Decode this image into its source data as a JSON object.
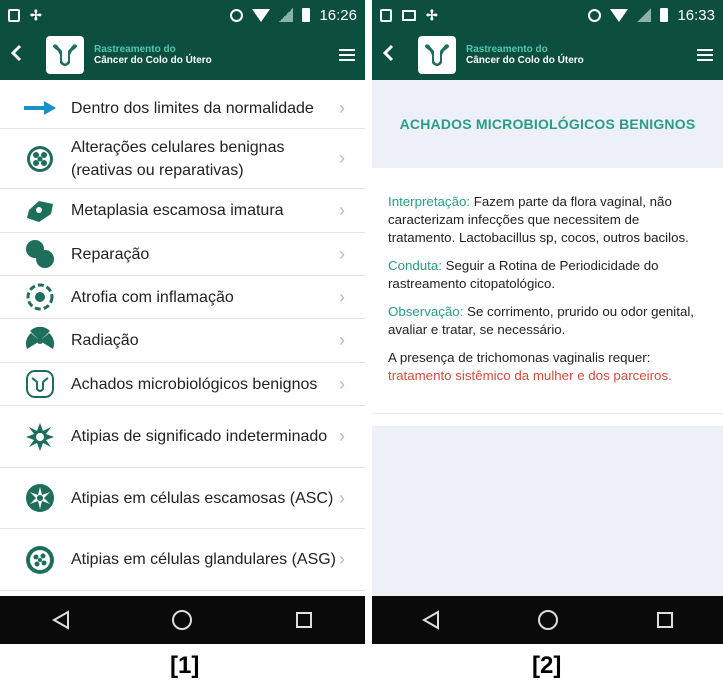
{
  "screen1": {
    "status": {
      "time": "16:26"
    },
    "header": {
      "brand_line1": "Rastreamento do",
      "brand_line2": "Câncer do Colo do Útero"
    },
    "items": [
      {
        "label": "Dentro dos limites da normalidade",
        "icon": "arrow-right-icon"
      },
      {
        "label": "Alterações celulares benignas (reativas ou reparativas)",
        "icon": "cell-cluster-icon"
      },
      {
        "label": "Metaplasia escamosa imatura",
        "icon": "metaplasia-cell-icon"
      },
      {
        "label": "Reparação",
        "icon": "repair-cells-icon"
      },
      {
        "label": "Atrofia com inflamação",
        "icon": "atrophy-cell-icon"
      },
      {
        "label": "Radiação",
        "icon": "radiation-icon"
      },
      {
        "label": "Achados microbiológicos benignos",
        "icon": "uterus-icon"
      },
      {
        "label": "Atipias de significado indeterminado",
        "icon": "atypia-spiky-icon"
      },
      {
        "label": "Atipias em células escamosas (ASC)",
        "icon": "asc-cell-icon"
      },
      {
        "label": "Atipias em células glandulares (ASG)",
        "icon": "asg-cell-icon"
      }
    ],
    "caption": "[1]"
  },
  "screen2": {
    "status": {
      "time": "16:33"
    },
    "header": {
      "brand_line1": "Rastreamento do",
      "brand_line2": "Câncer do Colo do Útero"
    },
    "title": "ACHADOS MICROBIOLÓGICOS BENIGNOS",
    "interp_label": "Interpretação:",
    "interp_text": " Fazem parte da flora vaginal, não caracterizam infecções que necessitem de tratamento. Lactobacillus sp, cocos, outros bacilos.",
    "conduta_label": "Conduta:",
    "conduta_text": " Seguir a Rotina de Periodicidade do rastreamento citopatológico.",
    "obs_label": "Observação:",
    "obs_text": " Se corrimento, prurido ou odor genital, avaliar e tratar, se necessário.",
    "tricho_text": "A presença de trichomonas vaginalis requer:",
    "tricho_red": "tratamento sistêmico da mulher e dos parceiros.",
    "caption": "[2]"
  },
  "colors": {
    "header": "#0d4f3f",
    "accent": "#2a9d86",
    "red": "#d94a3a",
    "icon_teal": "#1e6e5c"
  }
}
